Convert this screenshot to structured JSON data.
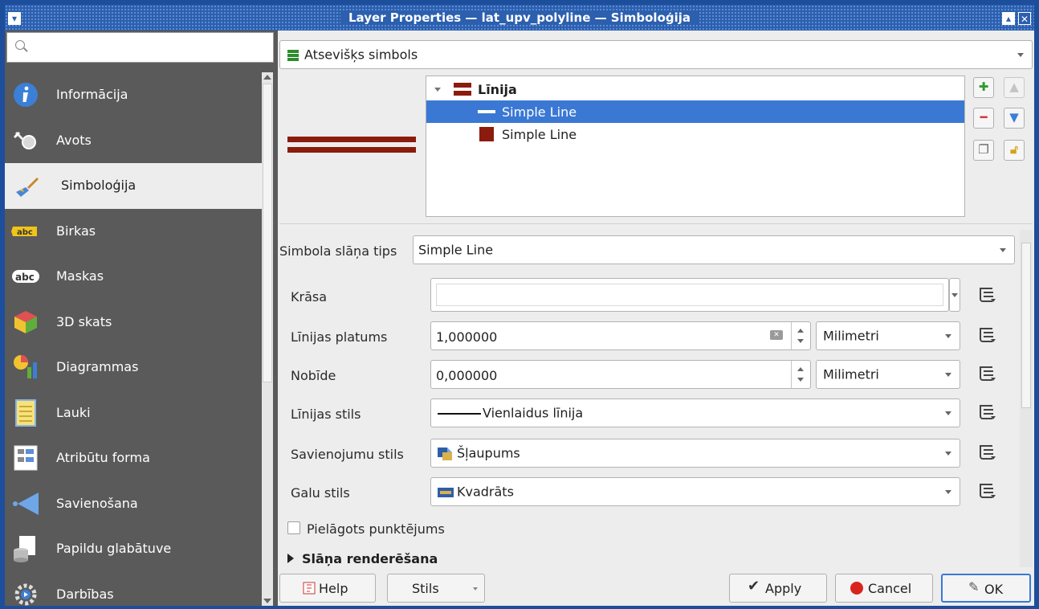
{
  "window": {
    "title": "Layer Properties — lat_upv_polyline — Simboloģija"
  },
  "sidebar": {
    "search_placeholder": "",
    "items": [
      {
        "label": "Informācija",
        "icon": "info-icon"
      },
      {
        "label": "Avots",
        "icon": "source-icon"
      },
      {
        "label": "Simboloģija",
        "icon": "symbology-brush-icon",
        "active": true
      },
      {
        "label": "Birkas",
        "icon": "labels-abc-icon"
      },
      {
        "label": "Maskas",
        "icon": "masks-abc-icon"
      },
      {
        "label": "3D skats",
        "icon": "cube-3d-icon"
      },
      {
        "label": "Diagrammas",
        "icon": "diagrams-icon"
      },
      {
        "label": "Lauki",
        "icon": "fields-icon"
      },
      {
        "label": "Atribūtu forma",
        "icon": "attribute-form-icon"
      },
      {
        "label": "Savienošana",
        "icon": "join-icon"
      },
      {
        "label": "Papildu glabātuve",
        "icon": "auxiliary-storage-icon"
      },
      {
        "label": "Darbības",
        "icon": "actions-gear-icon"
      }
    ]
  },
  "renderer": {
    "type_label": "Atsevišķs simbols"
  },
  "symbol_tree": {
    "root_label": "Līnija",
    "layers": [
      {
        "label": "Simple Line",
        "selected": true
      },
      {
        "label": "Simple Line",
        "selected": false
      }
    ],
    "color": "#8b1b0c"
  },
  "layer_props": {
    "layer_type_label": "Simbola slāņa tips",
    "layer_type_value": "Simple Line",
    "color_label": "Krāsa",
    "width_label": "Līnijas platums",
    "width_value": "1,000000",
    "width_unit": "Milimetri",
    "offset_label": "Nobīde",
    "offset_value": "0,000000",
    "offset_unit": "Milimetri",
    "style_label": "Līnijas stils",
    "style_value": "Vienlaidus līnija",
    "join_label": "Savienojumu stils",
    "join_value": "Šļaupums",
    "cap_label": "Galu stils",
    "cap_value": "Kvadrāts",
    "custom_dash_label": "Pielāgots punktējums",
    "layer_rendering_label": "Slāņa renderēšana"
  },
  "buttons": {
    "help": "Help",
    "style": "Stils",
    "apply": "Apply",
    "cancel": "Cancel",
    "ok": "OK"
  }
}
